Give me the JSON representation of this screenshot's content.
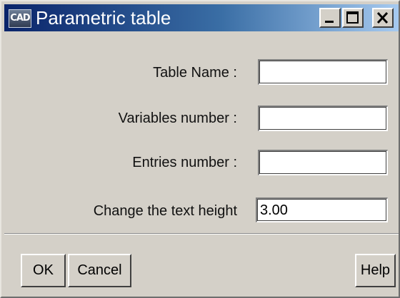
{
  "window": {
    "title": "Parametric table",
    "icon": "cad-app-icon",
    "icon_text": "CAD",
    "controls": {
      "minimize_icon": "minimize-icon",
      "maximize_icon": "maximize-icon",
      "close_icon": "close-icon"
    }
  },
  "form": {
    "table_name_label": "Table Name :",
    "table_name_value": "",
    "variables_number_label": "Variables number :",
    "variables_number_value": "",
    "entries_number_label": "Entries number :",
    "entries_number_value": "",
    "text_height_label": "Change the text height",
    "text_height_value": "3.00"
  },
  "buttons": {
    "ok": "OK",
    "cancel": "Cancel",
    "help": "Help"
  },
  "colors": {
    "titlebar_start": "#0a246a",
    "titlebar_end": "#a6caf0",
    "dialog_background": "#d4d0c8"
  }
}
